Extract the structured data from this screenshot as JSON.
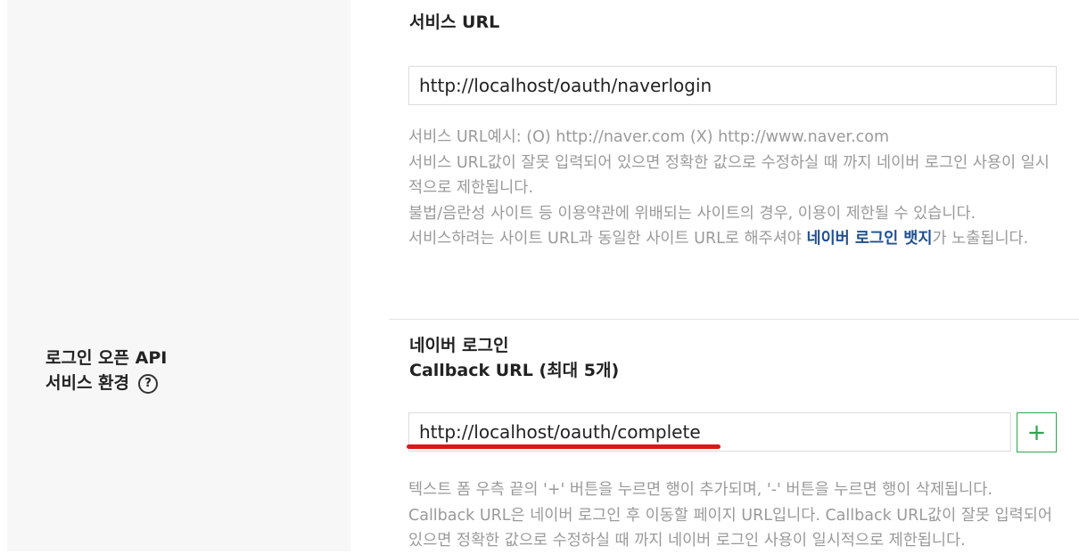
{
  "left_panel": {
    "label_line1": "로그인 오픈 API",
    "label_line2": "서비스 환경",
    "help_icon": "?"
  },
  "service_url": {
    "title": "서비스 URL",
    "value": "http://localhost/oauth/naverlogin",
    "help_lines": [
      "서비스 URL예시: (O) http://naver.com (X) http://www.naver.com",
      "서비스 URL값이 잘못 입력되어 있으면 정확한 값으로 수정하실 때 까지 네이버 로그인 사용이 일시적으로 제한됩니다.",
      "불법/음란성 사이트 등 이용약관에 위배되는 사이트의 경우, 이용이 제한될 수 있습니다."
    ],
    "badge_line_prefix": "서비스하려는 사이트 URL과 동일한 사이트 URL로 해주셔야 ",
    "badge_link": "네이버 로그인 뱃지",
    "badge_line_suffix": "가 노출됩니다."
  },
  "callback": {
    "title_line1": "네이버 로그인",
    "title_line2": "Callback URL (최대 5개)",
    "value": "http://localhost/oauth/complete",
    "add_button": "+",
    "help_lines": [
      "텍스트 폼 우측 끝의 '+' 버튼을 누르면 행이 추가되며, '-' 버튼을 누르면 행이 삭제됩니다.",
      "Callback URL은 네이버 로그인 후 이동할 페이지 URL입니다. Callback URL값이 잘못 입력되어 있으면 정확한 값으로 수정하실 때 까지 네이버 로그인 사용이 일시적으로 제한됩니다."
    ]
  },
  "colors": {
    "accent_green": "#2ea44f",
    "link_blue": "#1f4f8f",
    "annotation_red": "#e0141a"
  }
}
